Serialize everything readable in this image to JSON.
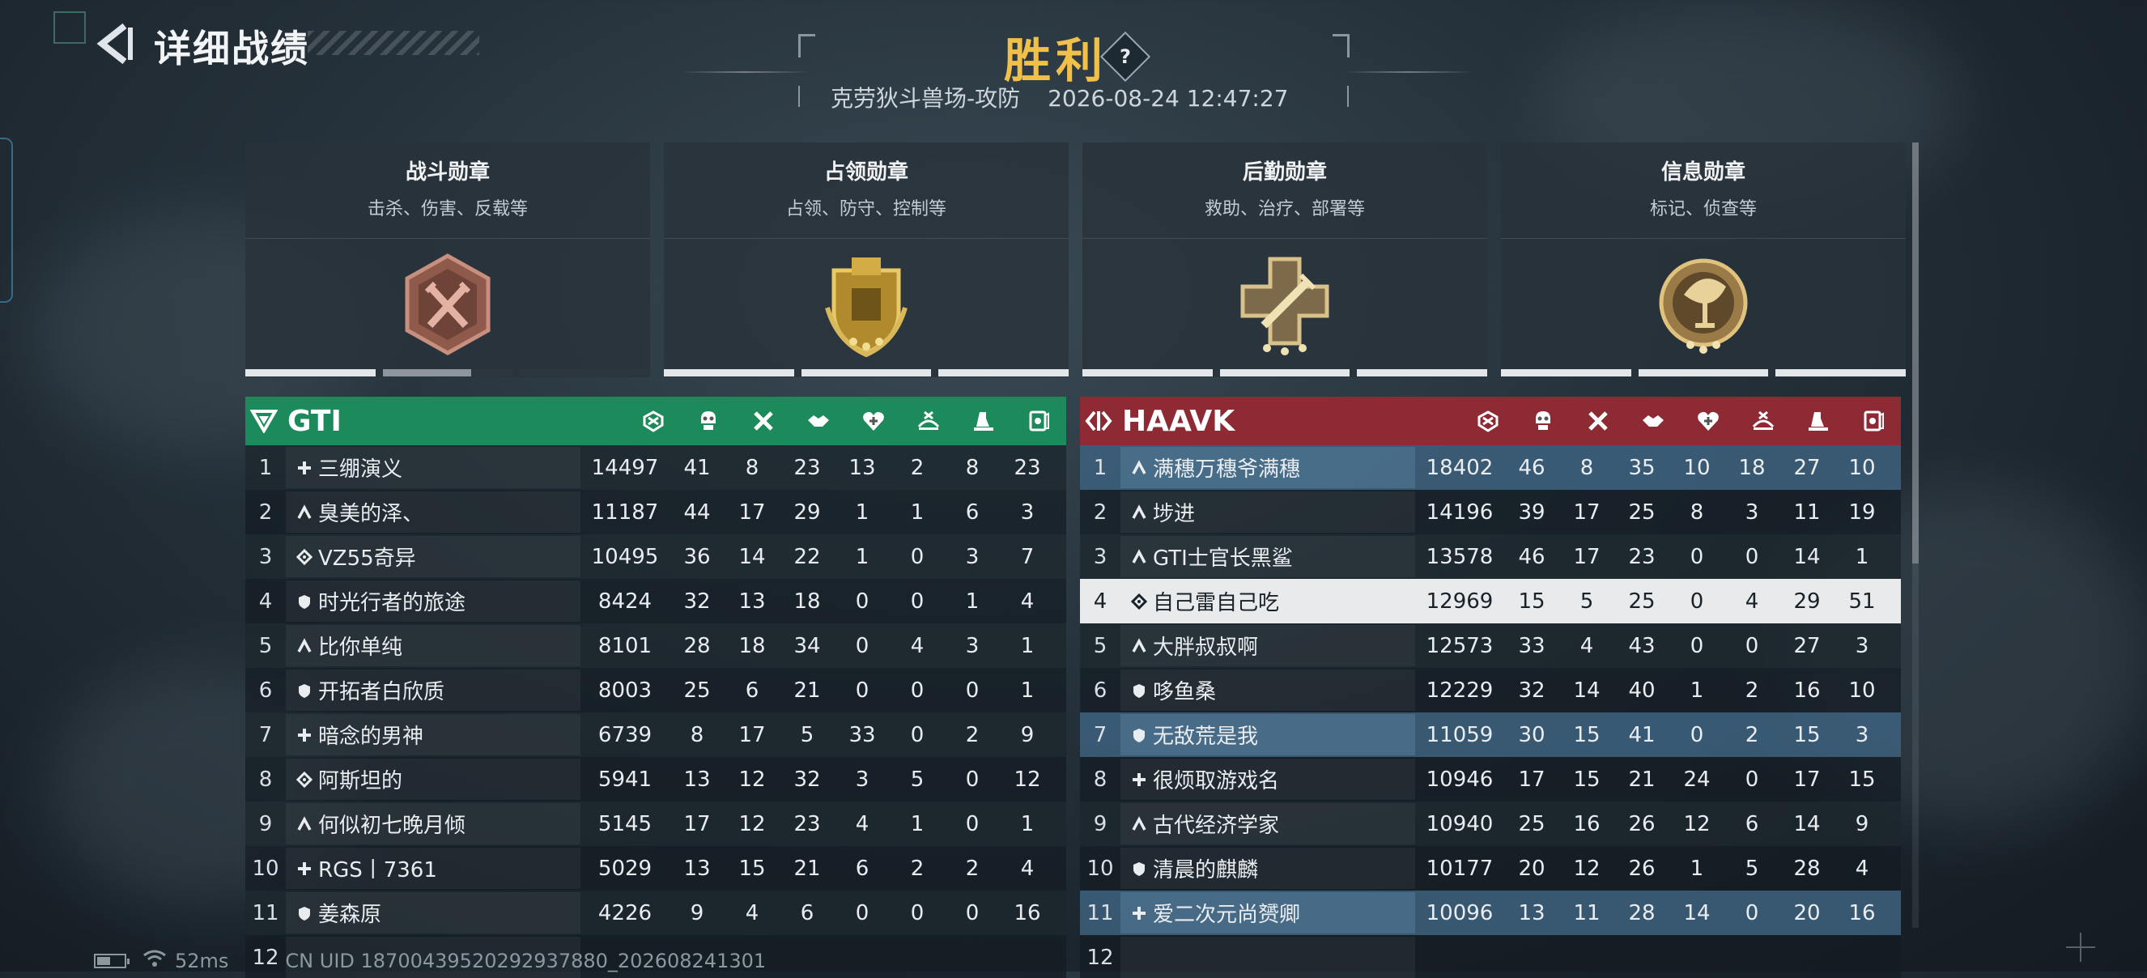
{
  "header": {
    "back_icon": "back-arrow-icon",
    "title": "详细战绩",
    "result": "胜利",
    "help_label": "?",
    "map_mode": "克劳狄斗兽场-攻防",
    "datetime": "2026-08-24 12:47:27"
  },
  "medals": [
    {
      "title": "战斗勋章",
      "desc": "击杀、伤害、反载等",
      "icon": "combat-medal-icon",
      "progress": [
        1.0,
        0.68,
        0.0
      ]
    },
    {
      "title": "占领勋章",
      "desc": "占领、防守、控制等",
      "icon": "capture-medal-icon",
      "progress": [
        1.0,
        1.0,
        1.0
      ]
    },
    {
      "title": "后勤勋章",
      "desc": "救助、治疗、部署等",
      "icon": "logistics-medal-icon",
      "progress": [
        1.0,
        1.0,
        1.0
      ]
    },
    {
      "title": "信息勋章",
      "desc": "标记、侦查等",
      "icon": "intel-medal-icon",
      "progress": [
        1.0,
        1.0,
        1.0
      ]
    }
  ],
  "stat_columns": [
    "score-icon",
    "kills-icon",
    "deaths-icon",
    "assists-icon",
    "revives-icon",
    "capture-icon",
    "deploy-icon",
    "intel-icon"
  ],
  "colors": {
    "team1": "#1c8a5a",
    "team2": "#8e2a34",
    "result": "#f0c048",
    "highlight_row": "#3c607c"
  },
  "teams": [
    {
      "name": "GTI",
      "icon": "team-triangle-icon",
      "players": [
        {
          "rank": "1",
          "cls": "assault",
          "name": "三绷演义",
          "score": "14497",
          "stats": [
            "41",
            "8",
            "23",
            "13",
            "2",
            "8",
            "23"
          ]
        },
        {
          "rank": "2",
          "cls": "engineer",
          "name": "臭美的泽、",
          "score": "11187",
          "stats": [
            "44",
            "17",
            "29",
            "1",
            "1",
            "6",
            "3"
          ]
        },
        {
          "rank": "3",
          "cls": "recon",
          "name": "VZ55奇异",
          "score": "10495",
          "stats": [
            "36",
            "14",
            "22",
            "1",
            "0",
            "3",
            "7"
          ]
        },
        {
          "rank": "4",
          "cls": "support",
          "name": "时光行者的旅途",
          "score": "8424",
          "stats": [
            "32",
            "13",
            "18",
            "0",
            "0",
            "1",
            "4"
          ]
        },
        {
          "rank": "5",
          "cls": "engineer",
          "name": "比你单纯",
          "score": "8101",
          "stats": [
            "28",
            "18",
            "34",
            "0",
            "4",
            "3",
            "1"
          ]
        },
        {
          "rank": "6",
          "cls": "support",
          "name": "开拓者白欣质",
          "score": "8003",
          "stats": [
            "25",
            "6",
            "21",
            "0",
            "0",
            "0",
            "1"
          ]
        },
        {
          "rank": "7",
          "cls": "assault",
          "name": "暗念的男神",
          "score": "6739",
          "stats": [
            "8",
            "17",
            "5",
            "33",
            "0",
            "2",
            "9"
          ]
        },
        {
          "rank": "8",
          "cls": "recon",
          "name": "阿斯坦的",
          "score": "5941",
          "stats": [
            "13",
            "12",
            "32",
            "3",
            "5",
            "0",
            "12"
          ]
        },
        {
          "rank": "9",
          "cls": "engineer",
          "name": "何似初七晚月倾",
          "score": "5145",
          "stats": [
            "17",
            "12",
            "23",
            "4",
            "1",
            "0",
            "1"
          ]
        },
        {
          "rank": "10",
          "cls": "assault",
          "name": "RGS丨7361",
          "score": "5029",
          "stats": [
            "13",
            "15",
            "21",
            "6",
            "2",
            "2",
            "4"
          ]
        },
        {
          "rank": "11",
          "cls": "support",
          "name": "姜森原",
          "score": "4226",
          "stats": [
            "9",
            "4",
            "6",
            "0",
            "0",
            "0",
            "16"
          ]
        },
        {
          "rank": "12",
          "cls": "assault",
          "name": "",
          "score": "",
          "stats": [
            "",
            "",
            "",
            "",
            "",
            "",
            ""
          ]
        }
      ]
    },
    {
      "name": "HAAVK",
      "icon": "team-bracket-icon",
      "players": [
        {
          "rank": "1",
          "cls": "engineer",
          "name": "满穗万穗爷满穗",
          "score": "18402",
          "stats": [
            "46",
            "8",
            "35",
            "10",
            "18",
            "27",
            "10"
          ],
          "hl": true
        },
        {
          "rank": "2",
          "cls": "engineer",
          "name": "埗进",
          "score": "14196",
          "stats": [
            "39",
            "17",
            "25",
            "8",
            "3",
            "11",
            "19"
          ]
        },
        {
          "rank": "3",
          "cls": "engineer",
          "name": "GTI士官长黑鲨",
          "score": "13578",
          "stats": [
            "46",
            "17",
            "23",
            "0",
            "0",
            "14",
            "1"
          ]
        },
        {
          "rank": "4",
          "cls": "recon",
          "name": "自己雷自己吃",
          "score": "12969",
          "stats": [
            "15",
            "5",
            "25",
            "0",
            "4",
            "29",
            "51"
          ],
          "self": true
        },
        {
          "rank": "5",
          "cls": "engineer",
          "name": "大胖叔叔啊",
          "score": "12573",
          "stats": [
            "33",
            "4",
            "43",
            "0",
            "0",
            "27",
            "3"
          ]
        },
        {
          "rank": "6",
          "cls": "support",
          "name": "哆鱼桑",
          "score": "12229",
          "stats": [
            "32",
            "14",
            "40",
            "1",
            "2",
            "16",
            "10"
          ]
        },
        {
          "rank": "7",
          "cls": "support",
          "name": "无敌荒是我",
          "score": "11059",
          "stats": [
            "30",
            "15",
            "41",
            "0",
            "2",
            "15",
            "3"
          ],
          "hl": true
        },
        {
          "rank": "8",
          "cls": "assault",
          "name": "很烦取游戏名",
          "score": "10946",
          "stats": [
            "17",
            "15",
            "21",
            "24",
            "0",
            "17",
            "15"
          ]
        },
        {
          "rank": "9",
          "cls": "engineer",
          "name": "古代经济学家",
          "score": "10940",
          "stats": [
            "25",
            "16",
            "26",
            "12",
            "6",
            "14",
            "9"
          ]
        },
        {
          "rank": "10",
          "cls": "support",
          "name": "清晨的麒麟",
          "score": "10177",
          "stats": [
            "20",
            "12",
            "26",
            "1",
            "5",
            "28",
            "4"
          ]
        },
        {
          "rank": "11",
          "cls": "assault",
          "name": "爱二次元尚赟卿",
          "score": "10096",
          "stats": [
            "13",
            "11",
            "28",
            "14",
            "0",
            "20",
            "16"
          ],
          "hl": true
        },
        {
          "rank": "12",
          "cls": "assault",
          "name": "",
          "score": "",
          "stats": [
            "",
            "",
            "",
            "",
            "",
            "",
            ""
          ]
        }
      ]
    }
  ],
  "footer": {
    "battery_icon": "battery-icon",
    "wifi_icon": "wifi-icon",
    "ping": "52ms",
    "uid": "CN UID 1870043952029293788​0_202608241301"
  }
}
